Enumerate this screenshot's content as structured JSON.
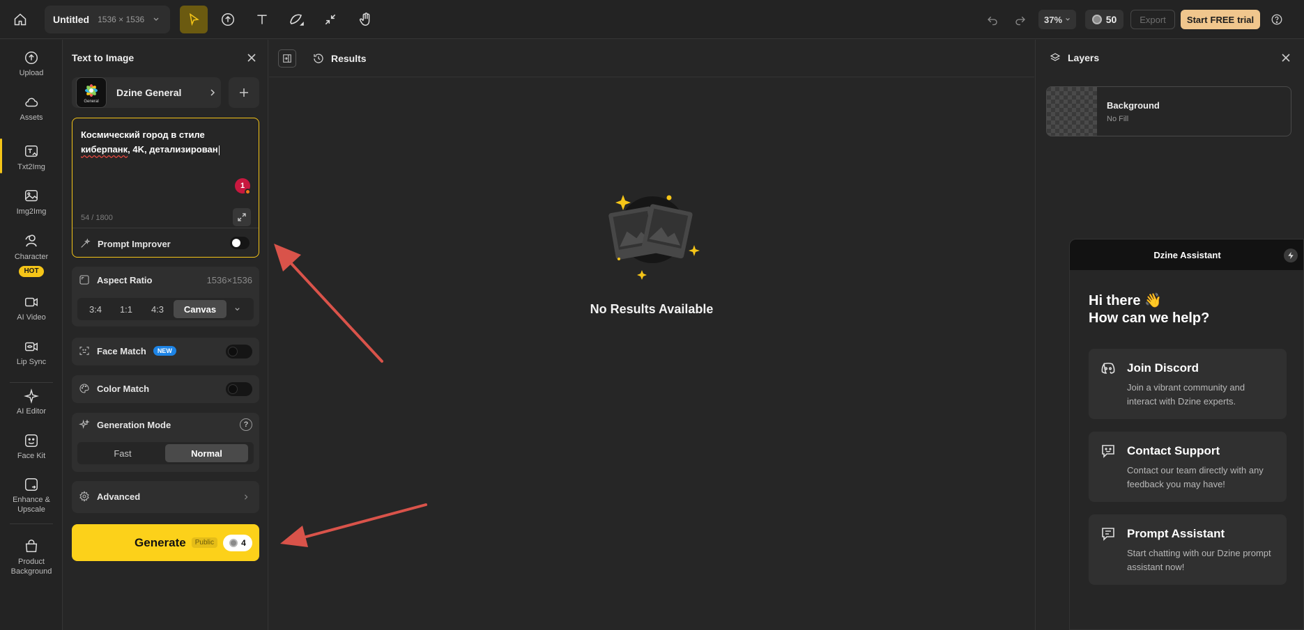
{
  "topbar": {
    "doc_title": "Untitled",
    "doc_size": "1536 × 1536",
    "zoom": "37%",
    "credits": "50",
    "export_label": "Export",
    "trial_prefix": "Start",
    "trial_bold": "FREE",
    "trial_suffix": "trial"
  },
  "rail": {
    "items": [
      {
        "label": "Upload"
      },
      {
        "label": "Assets"
      },
      {
        "label": "Txt2Img"
      },
      {
        "label": "Img2Img"
      },
      {
        "label": "Character",
        "badge": "HOT"
      },
      {
        "label": "AI Video"
      },
      {
        "label": "Lip Sync"
      },
      {
        "label": "AI Editor"
      },
      {
        "label": "Face Kit"
      },
      {
        "label": "Enhance &\nUpscale"
      },
      {
        "label": "Product\nBackground"
      }
    ]
  },
  "panel": {
    "title": "Text to Image",
    "model_name": "Dzine General",
    "model_thumb_caption": "General",
    "prompt_line1": "Космический город в стиле",
    "prompt_word_underlined": "киберпанк",
    "prompt_line2_rest": ", 4K, детализирован",
    "grammar_count": "1",
    "char_count": "54 / 1800",
    "prompt_improver": "Prompt Improver",
    "aspect_ratio": "Aspect Ratio",
    "aspect_size": "1536×1536",
    "aspect_options": [
      "3:4",
      "1:1",
      "4:3",
      "Canvas"
    ],
    "aspect_selected": "Canvas",
    "face_match": "Face Match",
    "new_badge": "NEW",
    "color_match": "Color Match",
    "generation_mode": "Generation Mode",
    "mode_options": [
      "Fast",
      "Normal"
    ],
    "mode_selected": "Normal",
    "advanced": "Advanced",
    "generate": "Generate",
    "public_tag": "Public",
    "generate_cost": "4"
  },
  "center": {
    "results_label": "Results",
    "empty_text": "No Results Available"
  },
  "layers": {
    "title": "Layers",
    "layer_name": "Background",
    "layer_fill": "No Fill"
  },
  "assistant": {
    "title": "Dzine Assistant",
    "greet_line1": "Hi there 👋",
    "greet_line2": "How can we help?",
    "cards": [
      {
        "title": "Join Discord",
        "desc": "Join a vibrant community and interact with Dzine experts."
      },
      {
        "title": "Contact Support",
        "desc": "Contact our team directly with any feedback you may have!"
      },
      {
        "title": "Prompt Assistant",
        "desc": "Start chatting with our Dzine prompt assistant now!"
      }
    ]
  },
  "colors": {
    "accent_yellow": "#fcd11a",
    "trial_bg": "#f0c68d",
    "new_badge": "#1d84e6",
    "annotation_arrow": "#d9534a",
    "background": "#262626"
  },
  "icons": [
    "home-icon",
    "select-arrow-icon",
    "upload-circle-icon",
    "text-icon",
    "pen-icon",
    "shrink-icon",
    "hand-icon",
    "undo-icon",
    "redo-icon",
    "help-icon"
  ]
}
